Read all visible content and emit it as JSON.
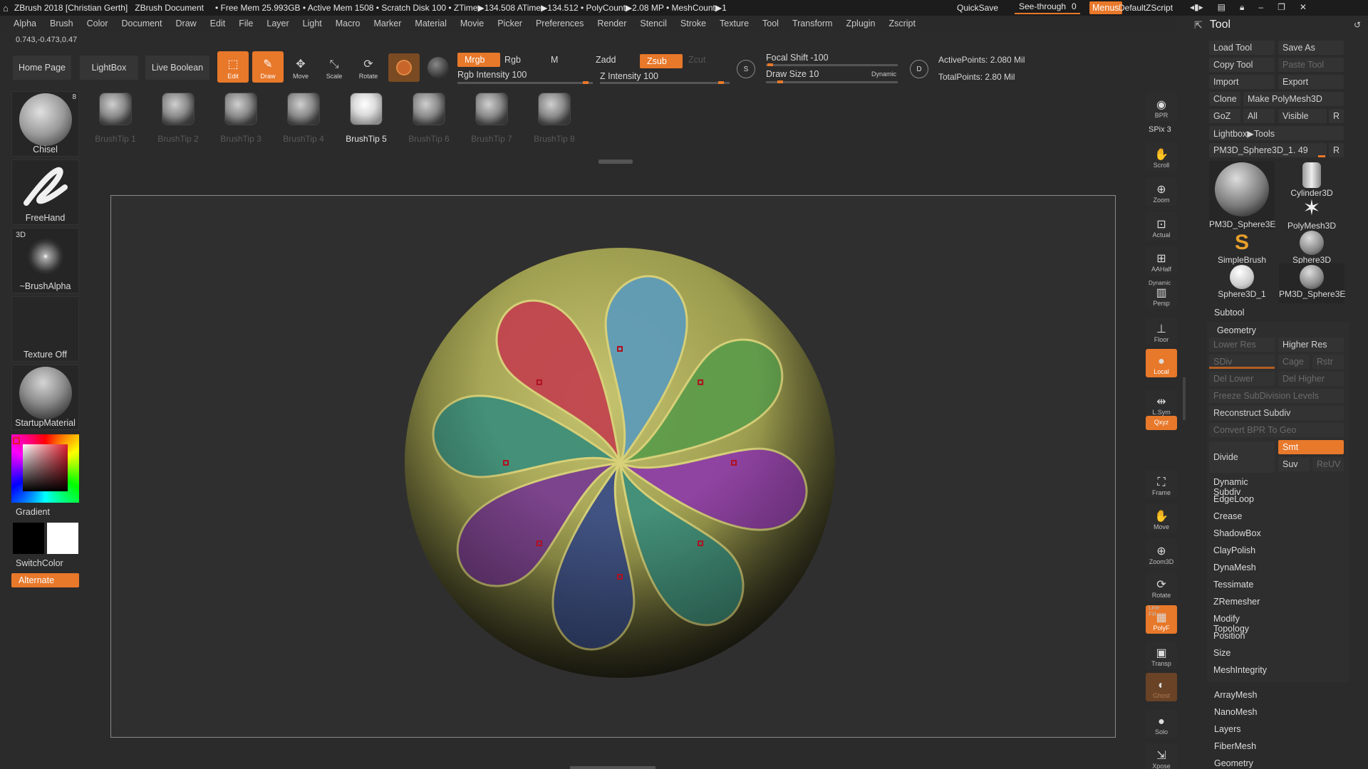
{
  "titlebar": {
    "app": "ZBrush 2018 [Christian Gerth]",
    "doc": "ZBrush Document",
    "stats": "• Free Mem 25.993GB • Active Mem 1508 • Scratch Disk 100 • ZTime▶134.508 ATime▶134.512 • PolyCount▶2.08 MP • MeshCount▶1",
    "quicksave": "QuickSave",
    "seethrough": "See-through",
    "seethrough_value": "0",
    "menus": "Menus",
    "zscript": "DefaultZScript"
  },
  "menubar": [
    "Alpha",
    "Brush",
    "Color",
    "Document",
    "Draw",
    "Edit",
    "File",
    "Layer",
    "Light",
    "Macro",
    "Marker",
    "Material",
    "Movie",
    "Picker",
    "Preferences",
    "Render",
    "Stencil",
    "Stroke",
    "Texture",
    "Tool",
    "Transform",
    "Zplugin",
    "Zscript"
  ],
  "coords": "0.743,-0.473,0.47",
  "toolbar": {
    "home": "Home Page",
    "lightbox": "LightBox",
    "liveboolean": "Live Boolean",
    "edit": "Edit",
    "draw": "Draw",
    "move": "Move",
    "scale": "Scale",
    "rotate": "Rotate",
    "mrgb": "Mrgb",
    "rgb": "Rgb",
    "m": "M",
    "zadd": "Zadd",
    "zsub": "Zsub",
    "zcut": "Zcut",
    "rgb_intensity": "Rgb Intensity 100",
    "z_intensity": "Z Intensity 100",
    "focal_shift": "Focal Shift -100",
    "draw_size": "Draw Size 10",
    "dynamic": "Dynamic",
    "active_points": "ActivePoints: 2.080 Mil",
    "total_points": "TotalPoints: 2.80 Mil"
  },
  "brushtips": [
    "BrushTip 1",
    "BrushTip 2",
    "BrushTip 3",
    "BrushTip 4",
    "BrushTip 5",
    "BrushTip 6",
    "BrushTip 7",
    "BrushTip 8"
  ],
  "active_tip_index": 4,
  "left": {
    "chisel": "Chisel",
    "chisel_count": "8",
    "freehand": "FreeHand",
    "three_d": "3D",
    "brushalpha": "~BrushAlpha",
    "texture": "Texture Off",
    "material": "StartupMaterial",
    "gradient": "Gradient",
    "switchcolor": "SwitchColor",
    "alternate": "Alternate"
  },
  "shelf": [
    "BPR",
    "Scroll",
    "Zoom",
    "Actual",
    "AAHalf",
    "Persp",
    "Floor",
    "Local",
    "L.Sym",
    "Qxyz",
    "Frame",
    "Move",
    "Zoom3D",
    "Rotate",
    "PolyF",
    "Transp",
    "Ghost",
    "Solo",
    "Xpose"
  ],
  "shelf_extra": {
    "spix": "SPix 3",
    "dynamic": "Dynamic",
    "linefill": "Line Fill"
  },
  "tool": {
    "title": "Tool",
    "load": "Load Tool",
    "saveas": "Save As",
    "copy": "Copy Tool",
    "paste": "Paste Tool",
    "import": "Import",
    "export": "Export",
    "clone": "Clone",
    "make": "Make PolyMesh3D",
    "goz": "GoZ",
    "all": "All",
    "visible": "Visible",
    "r": "R",
    "lightbox_tools": "Lightbox▶Tools",
    "current": "PM3D_Sphere3D_1. 49",
    "thumbs": [
      "PM3D_Sphere3E",
      "Cylinder3D",
      "PolyMesh3D",
      "SimpleBrush",
      "Sphere3D",
      "Sphere3D_1",
      "PM3D_Sphere3E"
    ],
    "subtool": "Subtool",
    "geometry": "Geometry",
    "lower_res": "Lower Res",
    "higher_res": "Higher Res",
    "sdiv": "SDiv",
    "cage": "Cage",
    "rstr": "Rstr",
    "del_lower": "Del Lower",
    "del_higher": "Del Higher",
    "freeze": "Freeze SubDivision Levels",
    "reconstruct": "Reconstruct Subdiv",
    "convert": "Convert BPR To Geo",
    "divide": "Divide",
    "smt": "Smt",
    "suv": "Suv",
    "reuv": "ReUV",
    "geometry_items": [
      "Dynamic Subdiv",
      "EdgeLoop",
      "Crease",
      "ShadowBox",
      "ClayPolish",
      "DynaMesh",
      "Tessimate",
      "ZRemesher",
      "Modify Topology",
      "Position",
      "Size",
      "MeshIntegrity"
    ],
    "sections": [
      "ArrayMesh",
      "NanoMesh",
      "Layers",
      "FiberMesh",
      "Geometry HD"
    ]
  },
  "colors": {
    "accent": "#e8782a",
    "sphere_base": "#a7a857",
    "petal_red": "#c2454f",
    "petal_blue": "#5f9cb8",
    "petal_green": "#5e9c4b",
    "petal_purple": "#8f3fa6",
    "petal_teal": "#3f8f7a",
    "petal_navy": "#3c4f86",
    "petal_violet": "#7a3f8f"
  }
}
